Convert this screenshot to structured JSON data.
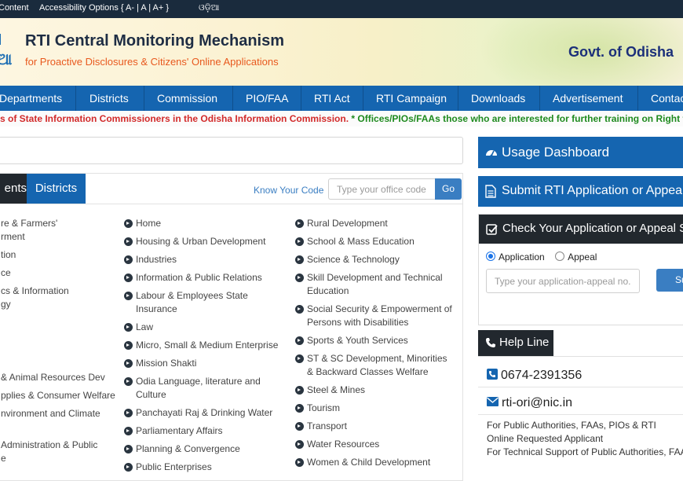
{
  "topbar": {
    "skip_content": "Content",
    "accessibility": "Accessibility Options {  A-  |  A  |  A+  }",
    "odia": "ଓଡ଼ିଆ"
  },
  "header": {
    "logo_fragment": "ଆ",
    "title": "RTI Central Monitoring Mechanism",
    "subtitle": "for Proactive Disclosures & Citizens' Online Applications",
    "gov": "Govt. of Odisha"
  },
  "nav": [
    "Departments",
    "Districts",
    "Commission",
    "PIO/FAA",
    "RTI Act",
    "RTI Campaign",
    "Downloads",
    "Advertisement",
    "Contac"
  ],
  "ticker": {
    "red": "s of State Information Commissioners in the Odisha Information Commission.",
    "green": " * Offices/PIOs/FAAs those who are interested for further training on Right to Information & I"
  },
  "tabs": {
    "departments": "ents",
    "districts": "Districts"
  },
  "know_code": {
    "label": "Know Your Code",
    "placeholder": "Type your office code",
    "go": "Go"
  },
  "col1": [
    "re & Farmers'",
    "rment",
    "tion",
    "ce",
    "cs & Information",
    "gy",
    "& Animal Resources Dev",
    "pplies & Consumer Welfare",
    "nvironment and Climate",
    "Administration & Public",
    "e"
  ],
  "col2": [
    "Home",
    "Housing & Urban Development",
    "Industries",
    "Information & Public Relations",
    "Labour & Employees State Insurance",
    "Law",
    "Micro, Small & Medium Enterprise",
    "Mission Shakti",
    "Odia Language, literature and Culture",
    "Panchayati Raj & Drinking Water",
    "Parliamentary Affairs",
    "Planning & Convergence",
    "Public Enterprises"
  ],
  "col3": [
    "Rural Development",
    "School & Mass Education",
    "Science & Technology",
    "Skill Development and Technical Education",
    "Social Security & Empowerment of Persons with Disabilities",
    "Sports & Youth Services",
    "ST & SC Development, Minorities & Backward Classes Welfare",
    "Steel & Mines",
    "Tourism",
    "Transport",
    "Water Resources",
    "Women & Child Development"
  ],
  "sidebar": {
    "usage": "Usage Dashboard",
    "submit": "Submit RTI Application or Appea",
    "check": "Check Your Application or Appeal S",
    "radio_application": "Application",
    "radio_appeal": "Appeal",
    "app_placeholder": "Type your application-appeal no.",
    "submit_btn": "Su",
    "helpline": "Help Line",
    "phone": "0674-2391356",
    "email": "rti-ori@nic.in",
    "note1": "For Public Authorities, FAAs, PIOs & RTI",
    "note2": "Online Requested Applicant",
    "note3": "For Technical Support of Public Authorities, FAAs"
  },
  "colors": {
    "nav_blue": "#1565b0",
    "dark": "#22282e",
    "topbar": "#1a2b3d",
    "accent_orange": "#e8591e",
    "gov_blue": "#1b2f7a"
  }
}
